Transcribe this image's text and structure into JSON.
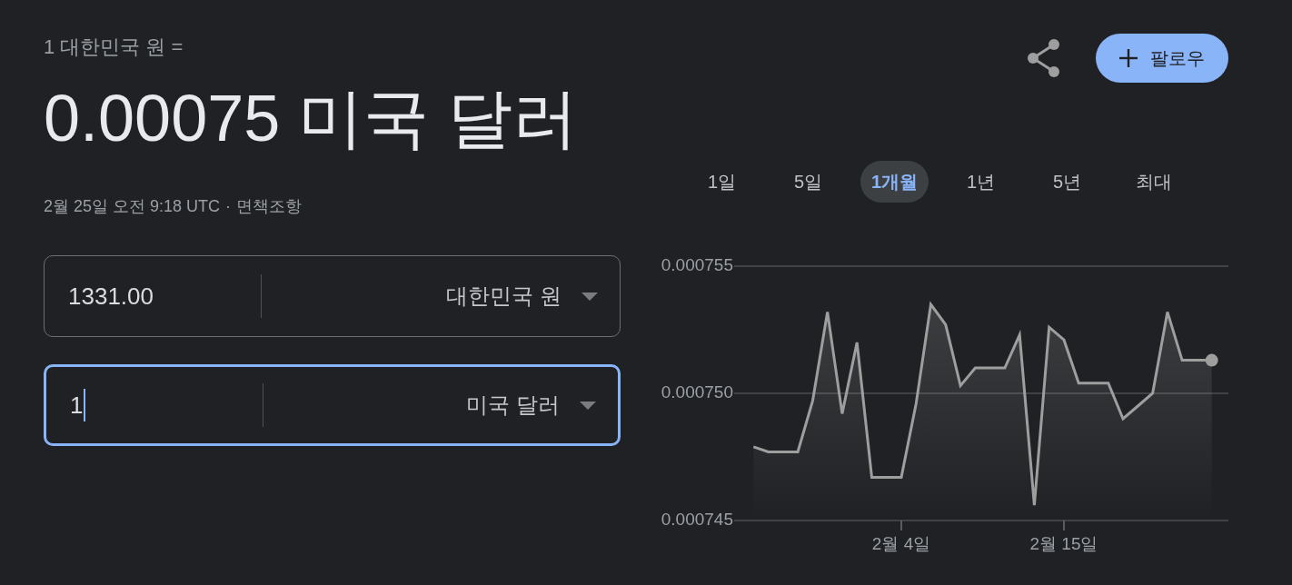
{
  "header": {
    "base_amount": "1 대한민국 원 =",
    "converted": "0.00075 미국 달러",
    "timestamp": "2월 25일 오전 9:18 UTC",
    "separator": "·",
    "disclaimer": "면책조항"
  },
  "follow_button": {
    "label": "팔로우"
  },
  "converter": [
    {
      "amount": "1331.00",
      "currency": "대한민국 원",
      "focused": false
    },
    {
      "amount": "1",
      "currency": "미국 달러",
      "focused": true
    }
  ],
  "ranges": [
    {
      "label": "1일",
      "selected": false
    },
    {
      "label": "5일",
      "selected": false
    },
    {
      "label": "1개월",
      "selected": true
    },
    {
      "label": "1년",
      "selected": false
    },
    {
      "label": "5년",
      "selected": false
    },
    {
      "label": "최대",
      "selected": false
    }
  ],
  "chart": {
    "chart_data": {
      "type": "area",
      "categories": [
        null,
        null,
        null,
        null,
        null,
        null,
        null,
        null,
        null,
        null,
        "2월 4일",
        null,
        null,
        null,
        null,
        null,
        null,
        null,
        null,
        null,
        null,
        "2월 15일",
        null,
        null,
        null,
        null,
        null,
        null,
        null,
        null,
        null,
        null
      ],
      "series": [
        {
          "color": "#9e9e9e",
          "values": [
            0.0007479,
            0.0007477,
            0.0007477,
            0.0007477,
            0.0007497,
            0.0007532,
            0.0007492,
            0.000752,
            0.0007467,
            0.0007467,
            0.0007467,
            0.0007496,
            0.0007535,
            0.0007527,
            0.0007503,
            0.000751,
            0.000751,
            0.000751,
            0.0007523,
            0.0007456,
            0.0007526,
            0.0007521,
            0.0007504,
            0.0007504,
            0.0007504,
            0.000749,
            0.0007495,
            0.00075,
            0.0007532,
            0.0007513,
            0.0007513,
            0.0007513
          ]
        }
      ],
      "ylim": [
        0.000745,
        0.000755
      ],
      "yticks": [
        {
          "value": 0.000745,
          "label": "0.000745"
        },
        {
          "value": 0.00075,
          "label": "0.000750"
        },
        {
          "value": 0.000755,
          "label": "0.000755"
        }
      ]
    }
  }
}
